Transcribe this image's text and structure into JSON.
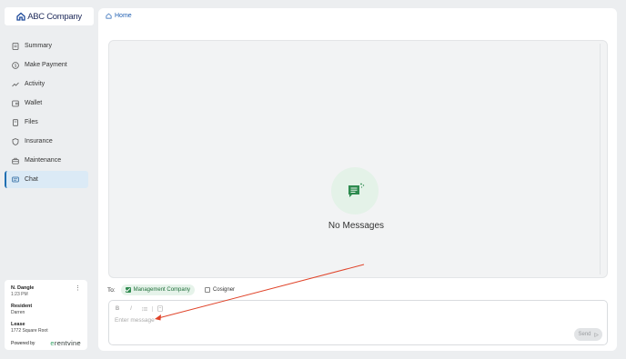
{
  "brand": {
    "logo_text": "ABC Company"
  },
  "sidebar": {
    "items": [
      {
        "label": "Summary",
        "icon": "document-icon"
      },
      {
        "label": "Make Payment",
        "icon": "dollar-icon"
      },
      {
        "label": "Activity",
        "icon": "trend-icon"
      },
      {
        "label": "Wallet",
        "icon": "wallet-icon"
      },
      {
        "label": "Files",
        "icon": "files-icon"
      },
      {
        "label": "Insurance",
        "icon": "shield-icon"
      },
      {
        "label": "Maintenance",
        "icon": "toolbox-icon"
      },
      {
        "label": "Chat",
        "icon": "chat-icon",
        "active": true
      }
    ]
  },
  "user_card": {
    "name": "N. Dangle",
    "time": "1:23 PM",
    "resident_label": "Resident",
    "resident_value": "Darren",
    "lease_label": "Lease",
    "lease_value": "1772 Square Root",
    "powered_by": "Powered by",
    "powered_brand_prefix": "e",
    "powered_brand": "rentvine"
  },
  "breadcrumb": {
    "home": "Home"
  },
  "messages": {
    "empty_text": "No Messages"
  },
  "recipients": {
    "to_label": "To:",
    "options": [
      {
        "label": "Management Company",
        "checked": true
      },
      {
        "label": "Cosigner",
        "checked": false
      }
    ]
  },
  "composer": {
    "placeholder": "Enter message",
    "send_label": "Send",
    "toolbar": [
      "B",
      "I",
      "list",
      "attach"
    ]
  },
  "colors": {
    "accent": "#1f6fb2",
    "green": "#2f8a4f",
    "annotation_arrow": "#e0442a"
  }
}
